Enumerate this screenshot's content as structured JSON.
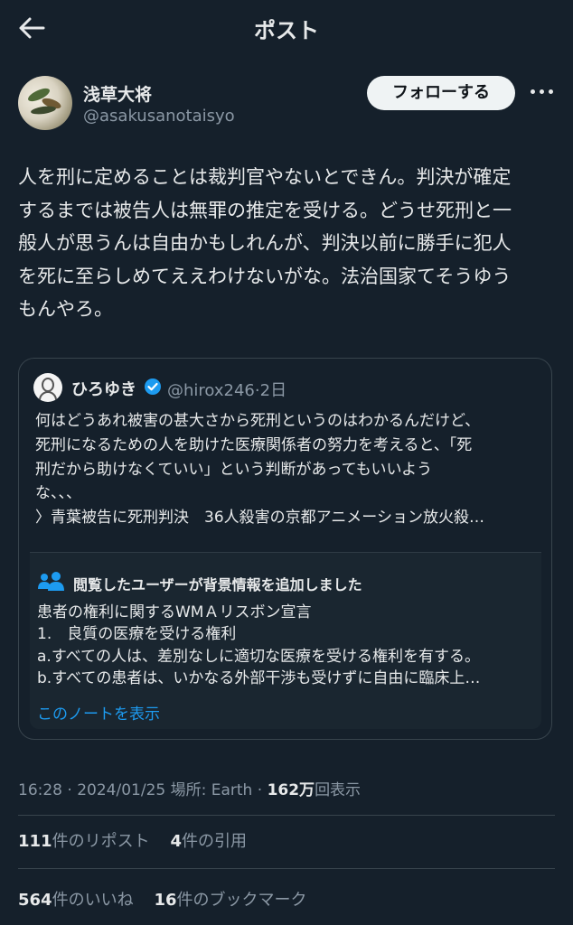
{
  "header": {
    "back_icon": "arrow-left-icon",
    "title": "ポスト"
  },
  "post": {
    "display_name": "浅草大将",
    "handle": "@asakusanotaisyo",
    "follow_label": "フォローする",
    "more_icon": "ellipsis-horizontal-icon",
    "text": "人を刑に定めることは裁判官やないとできん。判決が確定\nするまでは被告人は無罪の推定を受ける。どうせ死刑と一\n般人が思うんは自由かもしれんが、判決以前に勝手に犯人\nを死に至らしめてええわけないがな。法治国家てそうゆう\nもんやろ。"
  },
  "quote": {
    "display_name": "ひろゆき",
    "verified_icon": "verified-badge-icon",
    "handle": "@hirox246",
    "separator": "·",
    "age": "2日",
    "text": "何はどうあれ被害の甚大さから死刑というのはわかるんだけど、\n死刑になるための人を助けた医療関係者の努力を考えると、「死\n刑だから助けなくていい」という判断があってもいいよう\nな、、、\n〉青葉被告に死刑判決　36人殺害の京都アニメーション放火殺…"
  },
  "community_note": {
    "icon": "people-icon",
    "title": "閲覧したユーザーが背景情報を追加しました",
    "text": "患者の権利に関するWMＡリスボン宣言\n1.　良質の医療を受ける権利\na.すべての人は、差別なしに適切な医療を受ける権利を有する。\nb.すべての患者は、いかなる外部干渉も受けずに自由に臨床上…",
    "link": "このノートを表示"
  },
  "meta": {
    "time": "16:28",
    "date": "2024/01/25",
    "location_label": "場所: Earth",
    "dot": "·",
    "views_num": "162万",
    "views_label": "回表示"
  },
  "stats": {
    "reposts_num": "111",
    "reposts_label": "件のリポスト",
    "quotes_num": "4",
    "quotes_label": "件の引用",
    "likes_num": "564",
    "likes_label": "件のいいね",
    "bookmarks_num": "16",
    "bookmarks_label": "件のブックマーク"
  },
  "colors": {
    "background": "#15202b",
    "text": "#e7e9ea",
    "secondary": "#8b98a5",
    "accent": "#1d9bf0"
  }
}
